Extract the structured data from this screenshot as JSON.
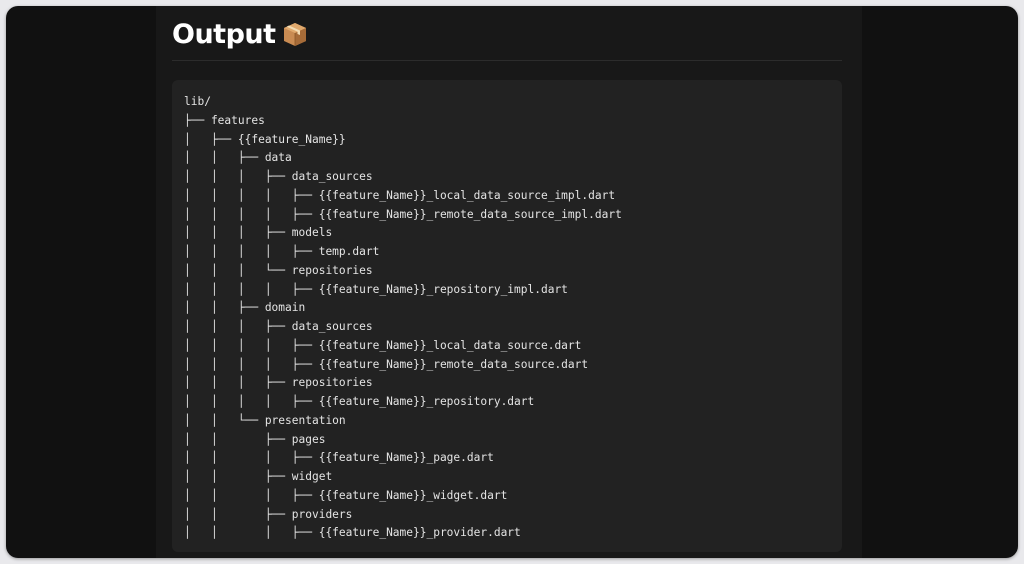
{
  "heading": {
    "title": "Output",
    "icon": "package-box-icon"
  },
  "code": {
    "lines": [
      "lib/",
      "├── features",
      "│   ├── {{feature_Name}}",
      "│   │   ├── data",
      "│   │   │   ├── data_sources",
      "│   │   │   │   ├── {{feature_Name}}_local_data_source_impl.dart",
      "│   │   │   │   ├── {{feature_Name}}_remote_data_source_impl.dart",
      "│   │   │   ├── models",
      "│   │   │   │   ├── temp.dart",
      "│   │   │   └── repositories",
      "│   │   │   │   ├── {{feature_Name}}_repository_impl.dart",
      "│   │   ├── domain",
      "│   │   │   ├── data_sources",
      "│   │   │   │   ├── {{feature_Name}}_local_data_source.dart",
      "│   │   │   │   ├── {{feature_Name}}_remote_data_source.dart",
      "│   │   │   ├── repositories",
      "│   │   │   │   ├── {{feature_Name}}_repository.dart",
      "│   │   └── presentation",
      "│   │       ├── pages",
      "│   │       │   ├── {{feature_Name}}_page.dart",
      "│   │       ├── widget",
      "│   │       │   ├── {{feature_Name}}_widget.dart",
      "│   │       ├── providers",
      "│   │       │   ├── {{feature_Name}}_provider.dart"
    ]
  },
  "colors": {
    "background": "#111111",
    "panel": "#181818",
    "code_background": "#222222",
    "text": "#e4e4e4"
  }
}
